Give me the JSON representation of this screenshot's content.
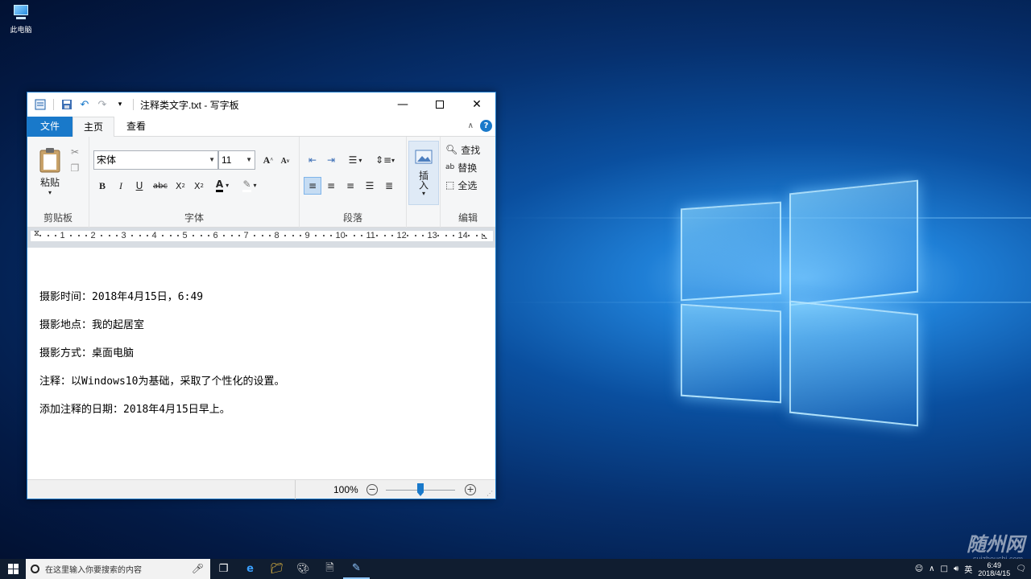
{
  "desktop": {
    "icon_label": "此电脑",
    "watermark": "随州网",
    "watermark_url": "suizhoushi.com"
  },
  "window": {
    "title": "注释类文字.txt - 写字板",
    "tabs": {
      "file": "文件",
      "home": "主页",
      "view": "查看"
    },
    "ribbon": {
      "clipboard": {
        "paste": "粘贴",
        "label": "剪贴板"
      },
      "font": {
        "family": "宋体",
        "size": "11",
        "label": "字体"
      },
      "paragraph": {
        "label": "段落"
      },
      "insert": {
        "label": "插入"
      },
      "edit": {
        "find": "查找",
        "replace": "替换",
        "select_all": "全选",
        "label": "编辑"
      }
    },
    "ruler_numbers": [
      "1",
      "2",
      "3",
      "4",
      "5",
      "6",
      "7",
      "8",
      "9",
      "10",
      "11",
      "12",
      "13",
      "14",
      "1"
    ],
    "document_lines": [
      "摄影时间：2018年4月15日，6:49",
      "摄影地点：我的起居室",
      "摄影方式：桌面电脑",
      "注释：以Windows10为基础，采取了个性化的设置。",
      "添加注释的日期：2018年4月15日早上。"
    ],
    "status": {
      "zoom": "100%",
      "zoom_level_percent": 100
    }
  },
  "taskbar": {
    "search_placeholder": "在这里输入你要搜索的内容",
    "ime": "英",
    "time": "6:49",
    "date": "2018/4/15"
  }
}
